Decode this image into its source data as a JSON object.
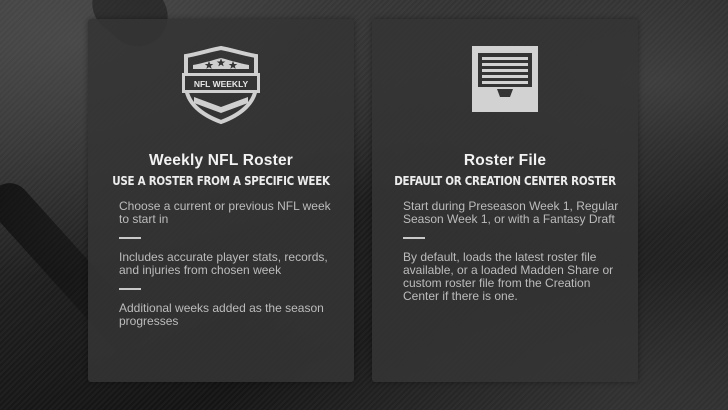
{
  "cards": [
    {
      "id": "weekly",
      "icon": "nfl-weekly-shield-icon",
      "icon_text": "NFL WEEKLY",
      "title": "Weekly NFL Roster",
      "subtitle": "USE A ROSTER FROM A SPECIFIC WEEK",
      "features": [
        "Choose a current or previous NFL week to start in",
        "Includes accurate player stats, records, and injuries from chosen week",
        "Additional weeks added as the season progresses"
      ]
    },
    {
      "id": "roster",
      "icon": "file-cabinet-icon",
      "title": "Roster File",
      "subtitle": "DEFAULT OR CREATION CENTER ROSTER",
      "features": [
        "Start during Preseason Week 1, Regular Season Week 1, or with a Fantasy Draft",
        "By default, loads the latest roster file available, or a loaded Madden Share or custom roster file from the Creation Center if there is one."
      ]
    }
  ],
  "colors": {
    "card_bg": "#343434",
    "title": "#f2f2f2",
    "body_text": "#bcbcbc",
    "icon": "#cfcfcf"
  }
}
